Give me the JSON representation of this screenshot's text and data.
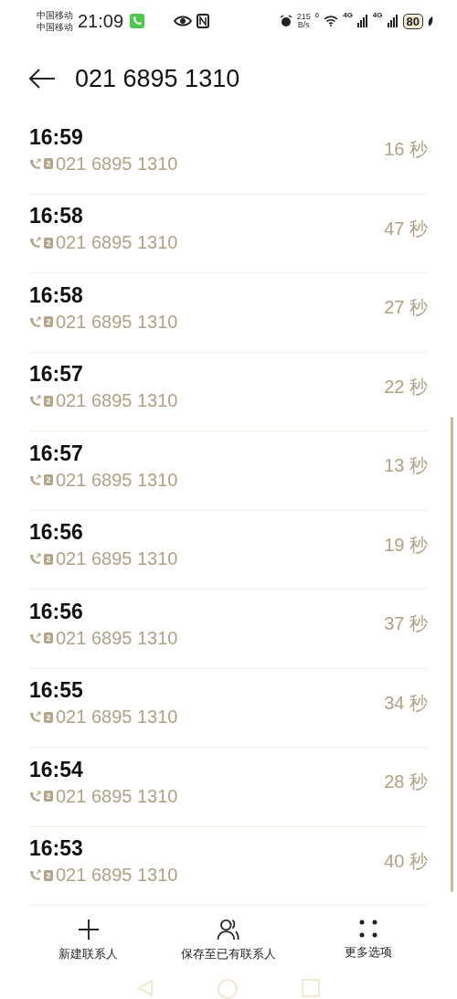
{
  "status_bar": {
    "carriers": [
      "中国移动",
      "中国移动"
    ],
    "time": "21:09",
    "speed_value": "215",
    "speed_unit": "B/s",
    "wifi_badge": "6",
    "network_1": "4G",
    "network_2": "4G",
    "battery": "80"
  },
  "header": {
    "title": "021 6895 1310"
  },
  "calls": [
    {
      "time": "16:59",
      "sim": "2",
      "number": "021 6895 1310",
      "duration": "16 秒"
    },
    {
      "time": "16:58",
      "sim": "2",
      "number": "021 6895 1310",
      "duration": "47 秒"
    },
    {
      "time": "16:58",
      "sim": "2",
      "number": "021 6895 1310",
      "duration": "27 秒"
    },
    {
      "time": "16:57",
      "sim": "2",
      "number": "021 6895 1310",
      "duration": "22 秒"
    },
    {
      "time": "16:57",
      "sim": "2",
      "number": "021 6895 1310",
      "duration": "13 秒"
    },
    {
      "time": "16:56",
      "sim": "2",
      "number": "021 6895 1310",
      "duration": "19 秒"
    },
    {
      "time": "16:56",
      "sim": "2",
      "number": "021 6895 1310",
      "duration": "37 秒"
    },
    {
      "time": "16:55",
      "sim": "2",
      "number": "021 6895 1310",
      "duration": "34 秒"
    },
    {
      "time": "16:54",
      "sim": "2",
      "number": "021 6895 1310",
      "duration": "28 秒"
    },
    {
      "time": "16:53",
      "sim": "2",
      "number": "021 6895 1310",
      "duration": "40 秒"
    }
  ],
  "actions": [
    {
      "kind": "plus",
      "label": "新建联系人"
    },
    {
      "kind": "person",
      "label": "保存至已有联系人"
    },
    {
      "kind": "dots",
      "label": "更多选项"
    }
  ]
}
